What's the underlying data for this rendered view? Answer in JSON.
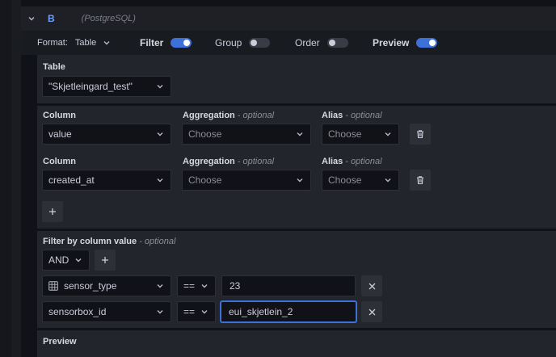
{
  "query": {
    "ref_id": "B",
    "datasource": "(PostgreSQL)"
  },
  "toolbar": {
    "format_label": "Format:",
    "format_value": "Table",
    "filter": {
      "label": "Filter",
      "on": true
    },
    "group": {
      "label": "Group",
      "on": false
    },
    "order": {
      "label": "Order",
      "on": false
    },
    "preview": {
      "label": "Preview",
      "on": true
    }
  },
  "table": {
    "label": "Table",
    "value": "\"Skjetleingard_test\""
  },
  "columns": {
    "column_label": "Column",
    "aggregation_label": "Aggregation",
    "alias_label": "Alias",
    "optional_text": "- optional",
    "rows": [
      {
        "column": "value",
        "aggregation": "Choose",
        "alias": "Choose"
      },
      {
        "column": "created_at",
        "aggregation": "Choose",
        "alias": "Choose"
      }
    ],
    "add_button": "+"
  },
  "filter": {
    "label": "Filter by column value",
    "optional_text": "- optional",
    "logic": "AND",
    "add_button": "+",
    "rows": [
      {
        "column": "sensor_type",
        "column_icon": "table-grid-icon",
        "operator": "==",
        "value": "23"
      },
      {
        "column": "sensorbox_id",
        "operator": "==",
        "value": "eui_skjetlein_2"
      }
    ]
  },
  "preview": {
    "label": "Preview"
  },
  "colors": {
    "accent": "#3d71d9",
    "background": "#111217",
    "panel": "#22252b"
  }
}
